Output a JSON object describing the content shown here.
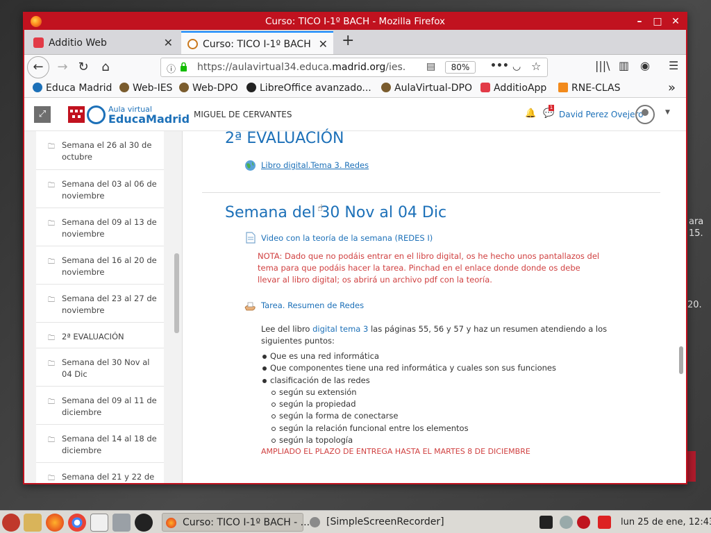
{
  "window": {
    "title": "Curso: TICO I-1º BACH - Mozilla Firefox",
    "controls": {
      "minimize": "–",
      "maximize": "□",
      "close": "✕"
    }
  },
  "tabs": [
    {
      "label": "Additio Web",
      "close": "✕",
      "icon": "additio-icon"
    },
    {
      "label": "Curso: TICO I-1º BACH",
      "close": "✕",
      "icon": "aulavirtual-icon",
      "active": true
    }
  ],
  "new_tab": "+",
  "nav": {
    "url_prefix": "https://aulavirtual34.educa.",
    "url_domain": "madrid.org",
    "url_rest": "/ies.",
    "zoom": "80%",
    "more": "•••"
  },
  "bookmarks": [
    {
      "label": "Educa Madrid",
      "color": "#1c70b8"
    },
    {
      "label": "Web-IES",
      "color": "#7a5c2e"
    },
    {
      "label": "Web-DPO",
      "color": "#7a5c2e"
    },
    {
      "label": "LibreOffice avanzado...",
      "color": "#222222"
    },
    {
      "label": "AulaVirtual-DPO",
      "color": "#7a5c2e"
    },
    {
      "label": "AdditioApp",
      "color": "#e23b47"
    },
    {
      "label": "RNE-CLAS",
      "color": "#f28a1c"
    }
  ],
  "bookmarks_more": "»",
  "header": {
    "logo_top": "Aula virtual",
    "logo_main": "EducaMadrid",
    "course": "MIGUEL DE CERVANTES",
    "msg_count": "1",
    "user": "David Perez Ovejero"
  },
  "drawer": [
    "Semana el 26 al 30 de octubre",
    "Semana del 03 al 06 de noviembre",
    "Semana del 09 al 13 de noviembre",
    "Semana del 16 al 20 de noviembre",
    "Semana del 23 al 27 de noviembre",
    "2ª EVALUACIÓN",
    "Semana del 30 Nov al 04 Dic",
    "Semana del 09 al 11 de diciembre",
    "Semana del 14 al 18 de diciembre",
    "Semana del 21 y 22 de"
  ],
  "main": {
    "section1_title": "2ª EVALUACIÓN",
    "section1_link": "Libro digital.Tema 3. Redes",
    "section2_title": "Semana del 30 Nov al 04 Dic",
    "video_link": "Video con la teoría de la semana (REDES I)",
    "nota": "NOTA: Dado que no podáis entrar en el libro digital, os he hecho unos pantallazos del tema para que podáis hacer la tarea. Pinchad en el enlace donde donde os debe llevar al libro digital; os abrirá un archivo pdf con la teoría.",
    "tarea_link": "Tarea. Resumen de Redes",
    "desc_before": "Lee del libro ",
    "desc_link": "digital tema 3",
    "desc_after": " las páginas 55, 56 y 57 y haz un resumen atendiendo a los siguientes puntos:",
    "bullets": [
      "Que es una red informática",
      "Que componentes tiene una red informática y cuales son sus funciones",
      "clasificación de las redes"
    ],
    "sub_bullets": [
      "según su extensión",
      "según la propiedad",
      "según la forma de conectarse",
      "según la relación funcional entre los elementos",
      "según la topología"
    ],
    "ampliado": "AMPLIADO EL PLAZO DE ENTREGA HASTA EL MARTES 8 DE DICIEMBRE"
  },
  "desktop_text": [
    "ara",
    "15.",
    "20."
  ],
  "taskbar": {
    "tasks": [
      {
        "label": "Curso: TICO I-1º BACH - ...",
        "active": true
      },
      {
        "label": "[SimpleScreenRecorder]",
        "active": false
      }
    ],
    "clock": "lun 25 de ene, 12:43"
  }
}
